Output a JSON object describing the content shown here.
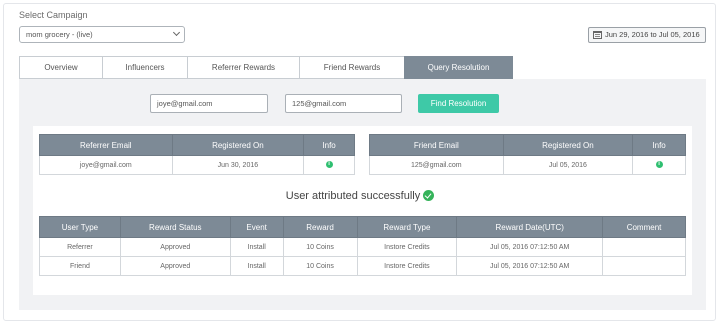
{
  "campaign": {
    "label": "Select Campaign",
    "selected": "mom grocery - (live)"
  },
  "date_range": "Jun 29, 2016 to Jul 05, 2016",
  "tabs": [
    {
      "label": "Overview"
    },
    {
      "label": "Influencers"
    },
    {
      "label": "Referrer Rewards"
    },
    {
      "label": "Friend Rewards"
    },
    {
      "label": "Query Resolution"
    }
  ],
  "query": {
    "referrer_email": "joye@gmail.com",
    "friend_email": "125@gmail.com",
    "find_label": "Find Resolution"
  },
  "referrer_table": {
    "headers": [
      "Referrer Email",
      "Registered On",
      "Info"
    ],
    "row": {
      "email": "joye@gmail.com",
      "registered": "Jun 30, 2016",
      "info": "i"
    }
  },
  "friend_table": {
    "headers": [
      "Friend Email",
      "Registered On",
      "Info"
    ],
    "row": {
      "email": "125@gmail.com",
      "registered": "Jul 05, 2016",
      "info": "i"
    }
  },
  "status_message": "User attributed successfully",
  "rewards_table": {
    "headers": [
      "User Type",
      "Reward Status",
      "Event",
      "Reward",
      "Reward Type",
      "Reward Date(UTC)",
      "Comment"
    ],
    "rows": [
      [
        "Referrer",
        "Approved",
        "Install",
        "10 Coins",
        "Instore Credits",
        "Jul 05, 2016 07:12:50 AM",
        ""
      ],
      [
        "Friend",
        "Approved",
        "Install",
        "10 Coins",
        "Instore Credits",
        "Jul 05, 2016 07:12:50 AM",
        ""
      ]
    ]
  },
  "colors": {
    "accent_button": "#3ec9a7",
    "header_gray": "#7d8a96",
    "success_green": "#35b35a"
  }
}
